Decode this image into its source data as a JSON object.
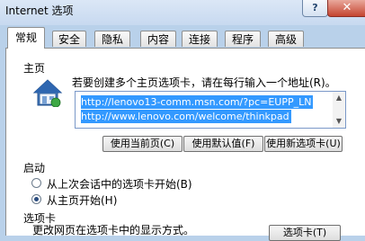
{
  "window": {
    "title": "Internet 选项",
    "help_label": "?",
    "close_label": "✕"
  },
  "tabs": [
    {
      "label": "常规",
      "active": true
    },
    {
      "label": "安全",
      "active": false
    },
    {
      "label": "隐私",
      "active": false
    },
    {
      "label": "内容",
      "active": false
    },
    {
      "label": "连接",
      "active": false
    },
    {
      "label": "程序",
      "active": false
    },
    {
      "label": "高级",
      "active": false
    }
  ],
  "homepage": {
    "section_label": "主页",
    "icon": "house-icon",
    "description": "若要创建多个主页选项卡，请在每行输入一个地址(R)。",
    "urls": [
      "http://lenovo13-comm.msn.com/?pc=EUPP_LN",
      "http://www.lenovo.com/welcome/thinkpad"
    ],
    "buttons": {
      "use_current": "使用当前页(C)",
      "use_default": "使用默认值(F)",
      "use_new_tab": "使用新选项卡(U)"
    }
  },
  "startup": {
    "section_label": "启动",
    "options": [
      {
        "label": "从上次会话中的选项卡开始(B)",
        "checked": false
      },
      {
        "label": "从主页开始(H)",
        "checked": true
      }
    ]
  },
  "tabs_section": {
    "section_label": "选项卡",
    "description": "更改网页在选项卡中的显示方式。",
    "button_label": "选项卡(T)"
  }
}
